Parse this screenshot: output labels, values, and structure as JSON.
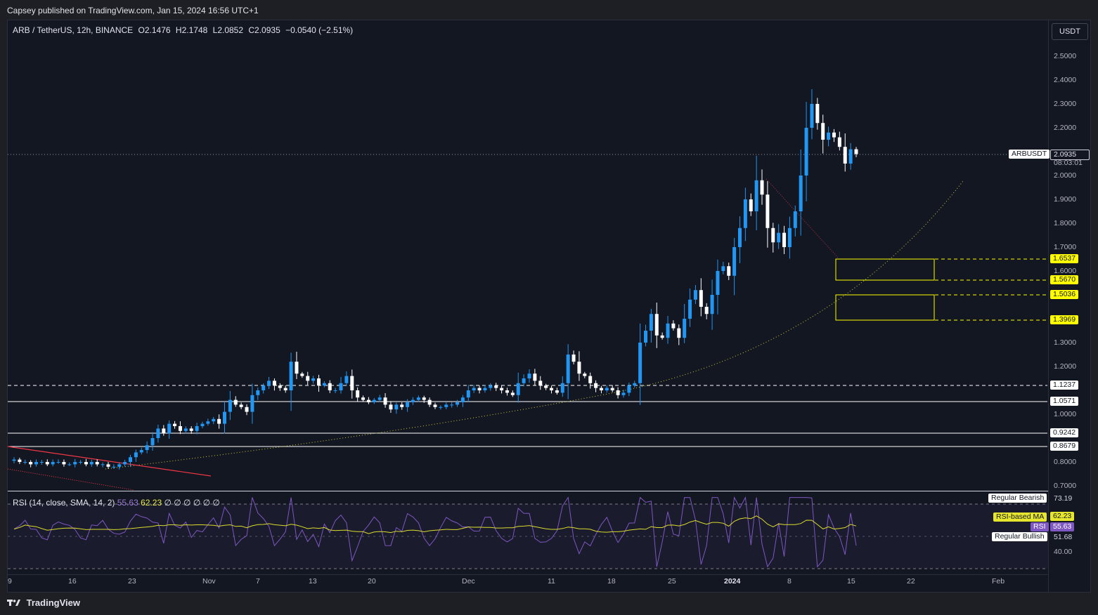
{
  "header": {
    "publisher": "Capsey published on TradingView.com, Jan 15, 2024 16:56 UTC+1"
  },
  "legend": {
    "symbol": "ARB / TetherUS, 12h, BINANCE",
    "open": "O2.1476",
    "high": "H2.1748",
    "low": "L2.0852",
    "close": "C2.0935",
    "change": "−0.0540 (−2.51%)"
  },
  "currency_button": "USDT",
  "price_scale": [
    "2.5000",
    "2.4000",
    "2.3000",
    "2.2000",
    "2.0000",
    "1.9000",
    "1.8000",
    "1.7000",
    "1.6000",
    "1.3000",
    "1.2000",
    "1.0000",
    "0.8000",
    "0.7000"
  ],
  "current_price": {
    "symbol_tag": "ARBUSDT",
    "price": "2.0935",
    "countdown": "08:03:01"
  },
  "levels": {
    "yellow": [
      "1.6537",
      "1.5670",
      "1.5036",
      "1.3969"
    ],
    "white": [
      "1.1237",
      "1.0571",
      "0.9242",
      "0.8679"
    ]
  },
  "rsi": {
    "title": "RSI (14, close, SMA, 14, 2)",
    "rsi_value": "55.63",
    "ma_value": "62.23",
    "na_markers": "∅ ∅ ∅ ∅ ∅ ∅",
    "scale": {
      "upper": "73.19",
      "lower": "51.68",
      "mid": "40.00"
    },
    "tags": {
      "regular_bearish": "Regular Bearish",
      "rsi_ma": "RSI-based MA",
      "rsi": "RSI",
      "regular_bullish": "Regular Bullish"
    },
    "tag_values": {
      "ma": "62.23",
      "rsi": "55.63"
    }
  },
  "time_axis": [
    "9",
    "16",
    "23",
    "Nov",
    "7",
    "13",
    "20",
    "Dec",
    "11",
    "18",
    "25",
    "2024",
    "8",
    "15",
    "22",
    "Feb"
  ],
  "brand": "TradingView",
  "colors": {
    "up": "#2196f3",
    "down": "#ffffff",
    "zone": "#ffff00",
    "trend": "#c9c93a",
    "resistance": "#f23645",
    "rsi": "#7e57c2",
    "rsi_ma": "#dbdb2e"
  },
  "chart_data": {
    "type": "candlestick",
    "timeframe": "12h",
    "x": [
      "2023-10-09",
      "2024-01-15"
    ],
    "ylim": [
      0.7,
      2.55
    ],
    "close_series": [
      0.81,
      0.8,
      0.8,
      0.79,
      0.8,
      0.8,
      0.79,
      0.8,
      0.8,
      0.79,
      0.79,
      0.8,
      0.8,
      0.79,
      0.8,
      0.79,
      0.79,
      0.78,
      0.78,
      0.79,
      0.8,
      0.82,
      0.84,
      0.85,
      0.87,
      0.9,
      0.94,
      0.92,
      0.96,
      0.95,
      0.93,
      0.94,
      0.93,
      0.95,
      0.96,
      0.97,
      0.98,
      0.96,
      1.01,
      1.06,
      1.04,
      1.03,
      1.01,
      1.08,
      1.1,
      1.12,
      1.14,
      1.12,
      1.11,
      1.1,
      1.22,
      1.17,
      1.16,
      1.14,
      1.15,
      1.12,
      1.13,
      1.1,
      1.1,
      1.13,
      1.16,
      1.1,
      1.07,
      1.06,
      1.05,
      1.06,
      1.07,
      1.04,
      1.02,
      1.04,
      1.03,
      1.05,
      1.06,
      1.07,
      1.06,
      1.04,
      1.03,
      1.03,
      1.04,
      1.04,
      1.05,
      1.07,
      1.1,
      1.11,
      1.1,
      1.11,
      1.12,
      1.11,
      1.1,
      1.09,
      1.08,
      1.13,
      1.15,
      1.17,
      1.14,
      1.12,
      1.11,
      1.1,
      1.09,
      1.13,
      1.25,
      1.22,
      1.17,
      1.16,
      1.13,
      1.11,
      1.1,
      1.11,
      1.1,
      1.08,
      1.09,
      1.12,
      1.13,
      1.3,
      1.35,
      1.42,
      1.33,
      1.32,
      1.38,
      1.36,
      1.32,
      1.4,
      1.48,
      1.52,
      1.45,
      1.42,
      1.5,
      1.6,
      1.62,
      1.58,
      1.7,
      1.78,
      1.9,
      1.85,
      1.98,
      1.92,
      1.78,
      1.72,
      1.76,
      1.7,
      1.78,
      1.85,
      2.0,
      2.2,
      2.3,
      2.22,
      2.15,
      2.18,
      2.16,
      2.12,
      2.05,
      2.11,
      2.09
    ]
  }
}
